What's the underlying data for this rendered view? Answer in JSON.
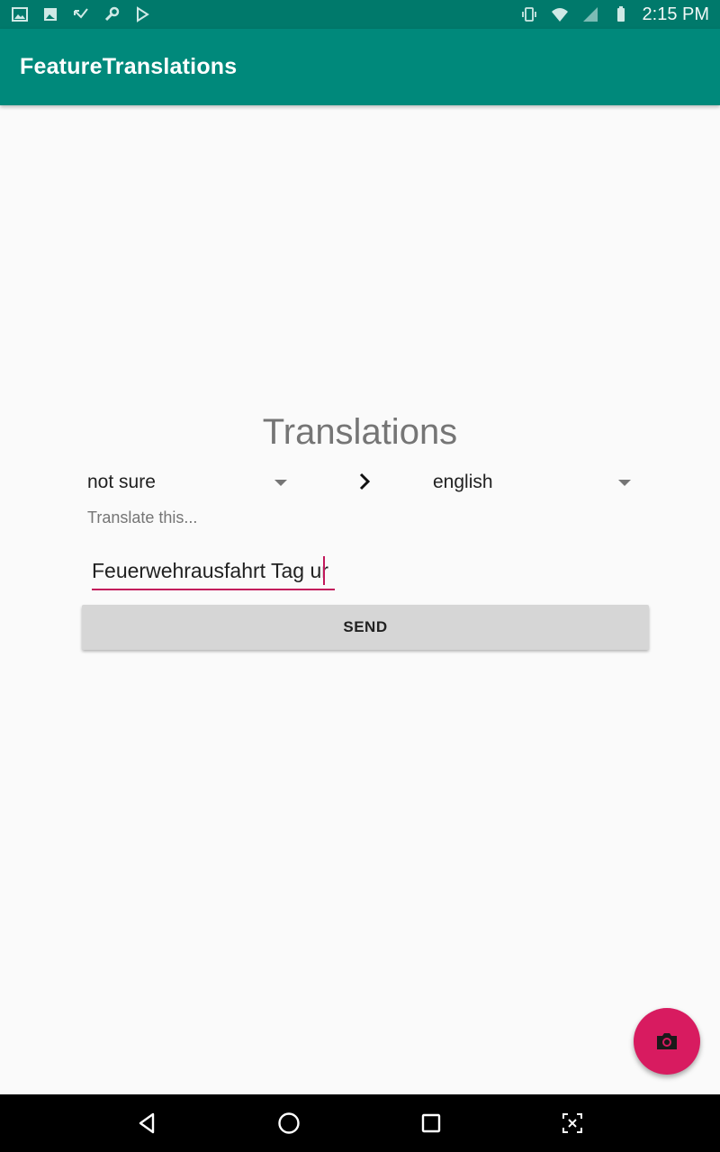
{
  "status_bar": {
    "time": "2:15 PM",
    "left_icons": [
      "image-icon",
      "photo-icon",
      "missed-call-icon",
      "wrench-icon",
      "play-store-icon"
    ],
    "right_icons": [
      "vibrate-icon",
      "wifi-icon",
      "signal-icon",
      "battery-icon"
    ]
  },
  "app_bar": {
    "title": "FeatureTranslations"
  },
  "main": {
    "title": "Translations",
    "source_language": {
      "selected": "not sure"
    },
    "target_language": {
      "selected": "english"
    },
    "input": {
      "label": "Translate this...",
      "value": "Feuerwehrausfahrt Tag ur"
    },
    "send_label": "SEND"
  },
  "fab": {
    "icon": "camera-icon"
  },
  "nav_bar": {
    "buttons": [
      "back-icon",
      "home-icon",
      "recents-icon",
      "screenshot-icon"
    ]
  },
  "colors": {
    "primary": "#00897b",
    "primary_dark": "#00796b",
    "accent": "#d81b60",
    "button": "#d6d6d6"
  }
}
